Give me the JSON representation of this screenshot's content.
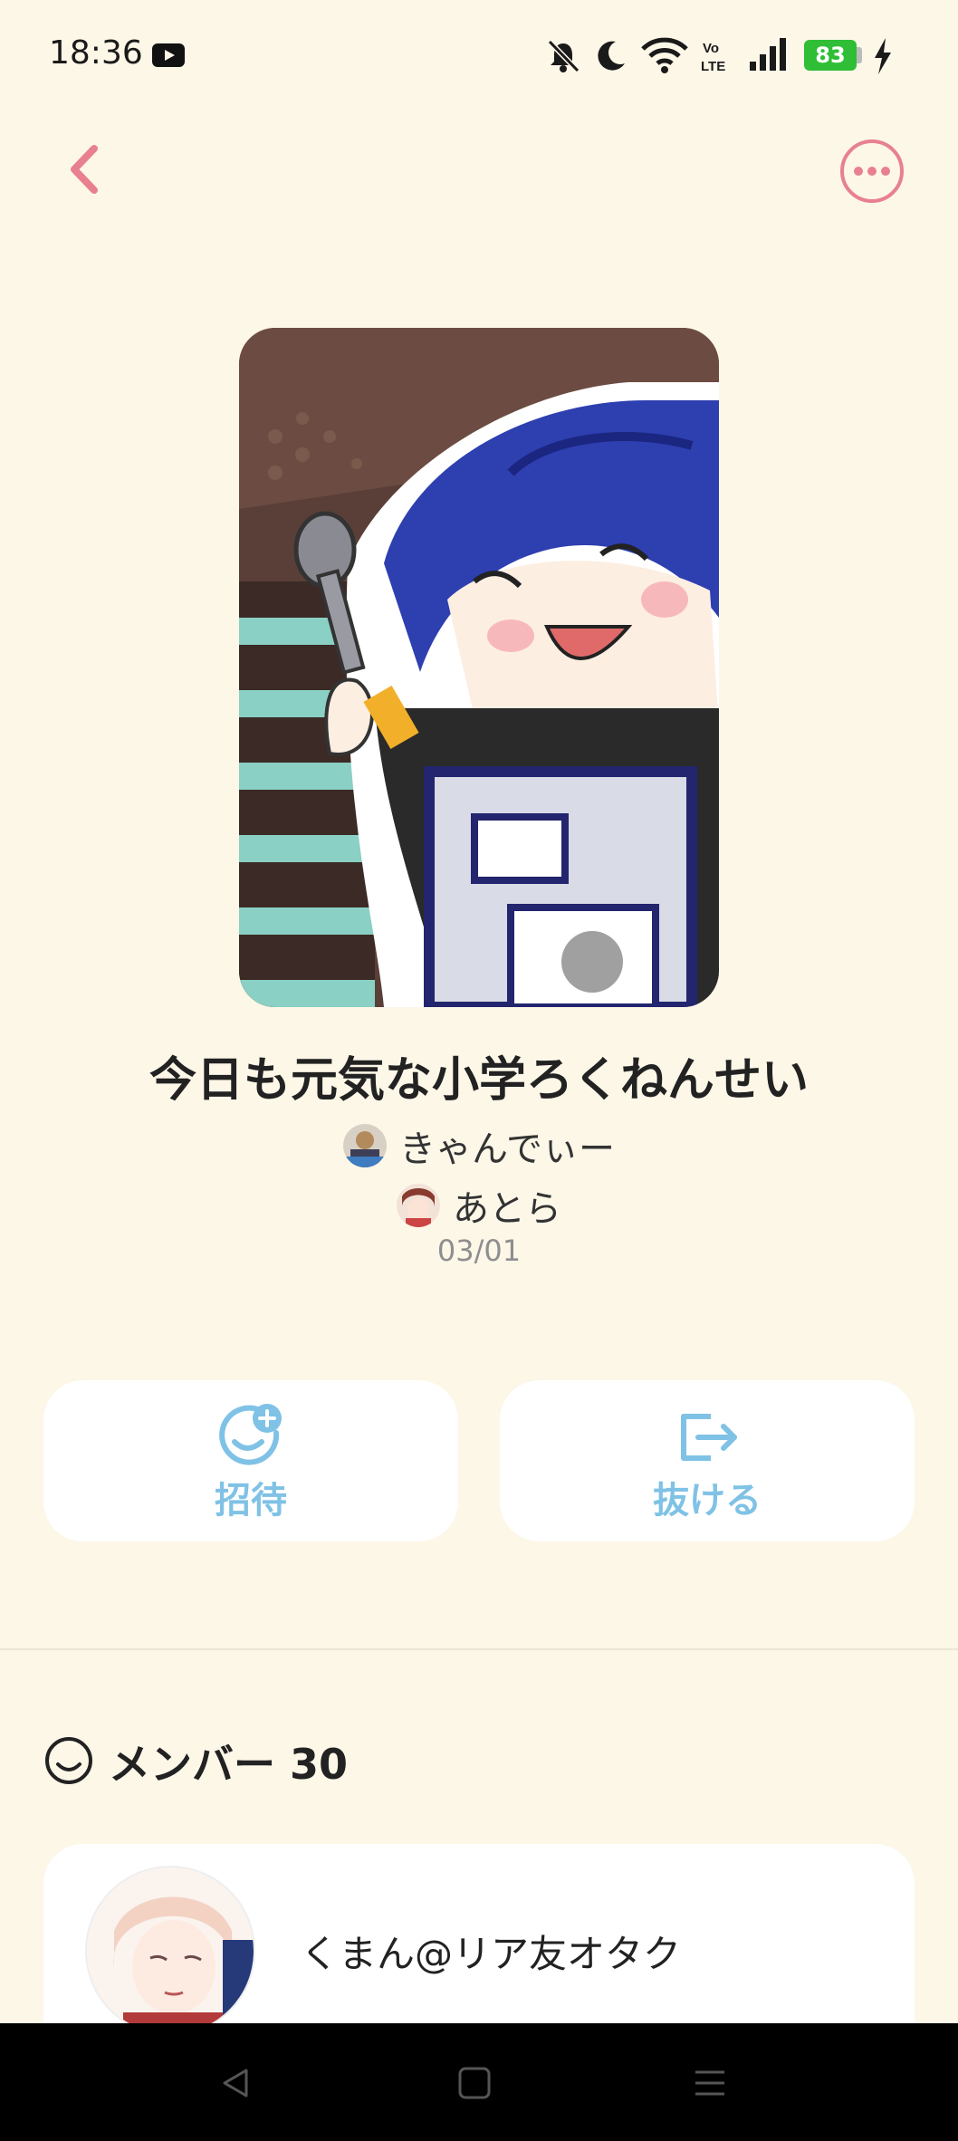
{
  "status_bar": {
    "time": "18:36",
    "battery_level": "83",
    "icons": [
      "youtube-icon",
      "mute-icon",
      "moon-icon",
      "wifi-icon",
      "volte-icon",
      "signal-icon",
      "battery-icon",
      "charging-icon"
    ]
  },
  "header": {
    "back_icon": "chevron-left-icon",
    "more_icon": "more-horizontal-icon",
    "accent_color": "#e8808f"
  },
  "album": {
    "title": "今日も元気な小学ろくねんせい",
    "owners": [
      "きゃんでぃー",
      "あとら"
    ],
    "date": "03/01"
  },
  "actions": {
    "invite_label": "招待",
    "leave_label": "抜ける",
    "color": "#7fc2e6"
  },
  "members": {
    "header_label": "メンバー 30",
    "list": [
      {
        "name": "くまん@リア友オタク"
      }
    ]
  }
}
